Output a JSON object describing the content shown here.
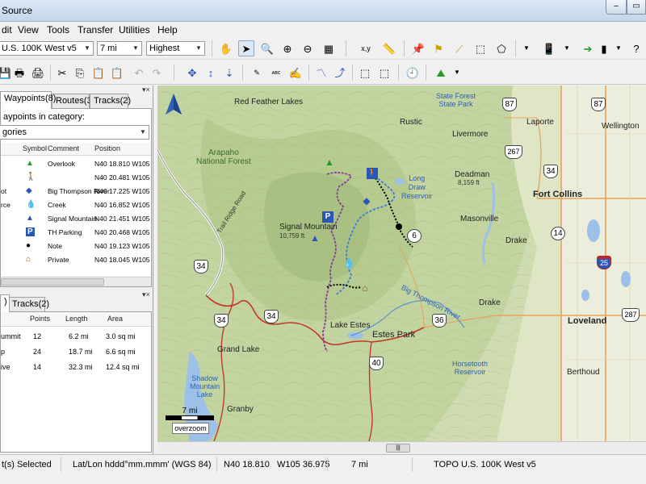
{
  "window": {
    "title": "Source"
  },
  "menu": [
    "dit",
    "View",
    "Tools",
    "Transfer",
    "Utilities",
    "Help"
  ],
  "toolbar": {
    "map_product": "U.S. 100K West v5",
    "zoom": "7 mi",
    "detail": "Highest",
    "coord_label": "x,y"
  },
  "left_panel": {
    "tabs": [
      "Waypoints(8)",
      "Routes(3)",
      "Tracks(2)"
    ],
    "category_label": "aypoints in category:",
    "category_value": "gories",
    "waypoint_columns": [
      "Symbol",
      "Comment",
      "Position"
    ],
    "waypoints": [
      {
        "name": "",
        "symbol": "triangle-green",
        "comment": "Overlook",
        "position": "N40 18.810 W105 36.975"
      },
      {
        "name": "",
        "symbol": "hiker",
        "comment": "",
        "position": "N40 20.481 W105 35.654"
      },
      {
        "name": "ot",
        "symbol": "fish",
        "comment": "Big Thompson River",
        "position": "N40 17.225 W105 38.650"
      },
      {
        "name": "rce",
        "symbol": "drop",
        "comment": "Creek",
        "position": "N40 16.852 W105 37.201"
      },
      {
        "name": "",
        "symbol": "mountain",
        "comment": "Signal Mountain",
        "position": "N40 21.451 W105 32.987"
      },
      {
        "name": "",
        "symbol": "parking",
        "comment": "TH Parking",
        "position": "N40 20.468 W105 35.607"
      },
      {
        "name": "",
        "symbol": "dot",
        "comment": "Note",
        "position": "N40 19.123 W105 34.210"
      },
      {
        "name": "",
        "symbol": "house",
        "comment": "Private",
        "position": "N40 18.045 W105 33.210"
      }
    ],
    "lower_tabs": [
      ")",
      "Tracks(2)"
    ],
    "route_columns": [
      "Points",
      "Length",
      "Area"
    ],
    "routes": [
      {
        "name": "ummit",
        "points": "12",
        "length": "6.2 mi",
        "area": "3.0 sq mi"
      },
      {
        "name": "p",
        "points": "24",
        "length": "18.7 mi",
        "area": "6.6 sq mi"
      },
      {
        "name": "ive",
        "points": "14",
        "length": "32.3 mi",
        "area": "12.4 sq mi"
      }
    ]
  },
  "map": {
    "labels": {
      "red_feather": "Red Feather Lakes",
      "state_forest": "State Forest\nState Park",
      "rustic": "Rustic",
      "livermore": "Livermore",
      "laporte": "Laporte",
      "wellington": "Wellington",
      "arapaho": "Arapaho\nNational Forest",
      "deadman": "Deadman",
      "deadman_elev": "8,159 ft",
      "long_draw": "Long\nDraw\nReservoir",
      "fort_collins": "Fort Collins",
      "trail_ridge": "Trail Ridge Road",
      "signal_mtn": "Signal Mountain",
      "signal_elev": "10,759 ft",
      "masonville": "Masonville",
      "drake1": "Drake",
      "drake2": "Drake",
      "big_thompson": "Big Thompson River",
      "lake_estes": "Lake Estes",
      "estes_park": "Estes Park",
      "loveland": "Loveland",
      "grand_lake": "Grand Lake",
      "horsetooth": "Horsetooth\nReservoir",
      "berthoud": "Berthoud",
      "shadow_mtn": "Shadow\nMountain\nLake",
      "granby": "Granby"
    },
    "shields": {
      "r87a": "87",
      "r87b": "87",
      "r267": "267",
      "r34a": "34",
      "r14": "14",
      "r6": "6",
      "r34b": "34",
      "r25": "25",
      "r34c": "34",
      "r36": "36",
      "r34d": "34",
      "r287": "287",
      "r40": "40"
    },
    "scale_label": "7 mi",
    "overzoom_label": "overzoom",
    "north_label": "N"
  },
  "status": {
    "selected": "t(s) Selected",
    "format": "Lat/Lon hddd°mm.mmm' (WGS 84)",
    "coords": "N40 18.810   W105 36.975",
    "scale": "7 mi",
    "product": "TOPO U.S. 100K West v5"
  },
  "colors": {
    "track_purple": "#8b3a9b",
    "track_blue": "#3a7ad8",
    "road_red": "#c0392b",
    "water": "#9cc0e8"
  }
}
